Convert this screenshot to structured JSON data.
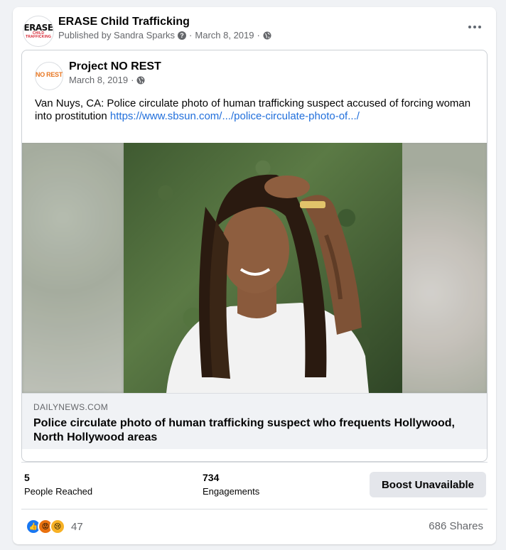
{
  "post": {
    "page_name": "ERASE Child Trafficking",
    "logo_line1": "ERASE",
    "logo_line2": "CHILD TRAFFICKING",
    "published_by": "Published by Sandra Sparks",
    "date": "March 8, 2019",
    "separator": "·"
  },
  "shared": {
    "page_name": "Project NO REST",
    "logo_text": "NO REST",
    "date": "March 8, 2019",
    "text": "Van Nuys, CA: Police circulate photo of human trafficking suspect accused of forcing woman into prostitution ",
    "link": "https://www.sbsun.com/.../police-circulate-photo-of.../"
  },
  "link_preview": {
    "domain": "DAILYNEWS.COM",
    "title": "Police circulate photo of human trafficking suspect who frequents Hollywood, North Hollywood areas"
  },
  "insights": {
    "reached_value": "5",
    "reached_label": "People Reached",
    "engagements_value": "734",
    "engagements_label": "Engagements",
    "boost_label": "Boost Unavailable"
  },
  "footer": {
    "reaction_count": "47",
    "shares": "686 Shares"
  },
  "colors": {
    "link": "#216fdb",
    "like": "#1877f2",
    "angry": "#e9710f",
    "sad": "#f7b125"
  }
}
